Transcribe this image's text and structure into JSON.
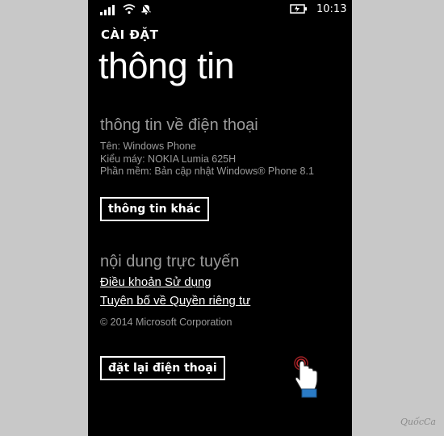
{
  "status_bar": {
    "time": "10:13",
    "icons": [
      "signal-icon",
      "wifi-icon",
      "bell-off-icon",
      "battery-charging-icon"
    ]
  },
  "header": {
    "app_title": "CÀI ĐẶT",
    "page_title": "thông tin"
  },
  "phone_info": {
    "heading": "thông tin về điện thoại",
    "name_line": "Tên: Windows Phone",
    "model_line": "Kiểu máy: NOKIA Lumia 625H",
    "software_line": "Phần mềm: Bản cập nhật Windows® Phone 8.1",
    "more_info_button": "thông tin khác"
  },
  "online_content": {
    "heading": "nội dung trực tuyến",
    "terms_link": "Điều khoản Sử dụng",
    "privacy_link": "Tuyên bố về Quyền riêng tư",
    "copyright": "© 2014 Microsoft Corporation"
  },
  "reset": {
    "button": "đặt lại điện thoại"
  },
  "colors": {
    "background": "#000000",
    "secondary_text": "#9a9a9a",
    "surround": "#c8c8c8"
  },
  "watermark": "QuốcCa"
}
